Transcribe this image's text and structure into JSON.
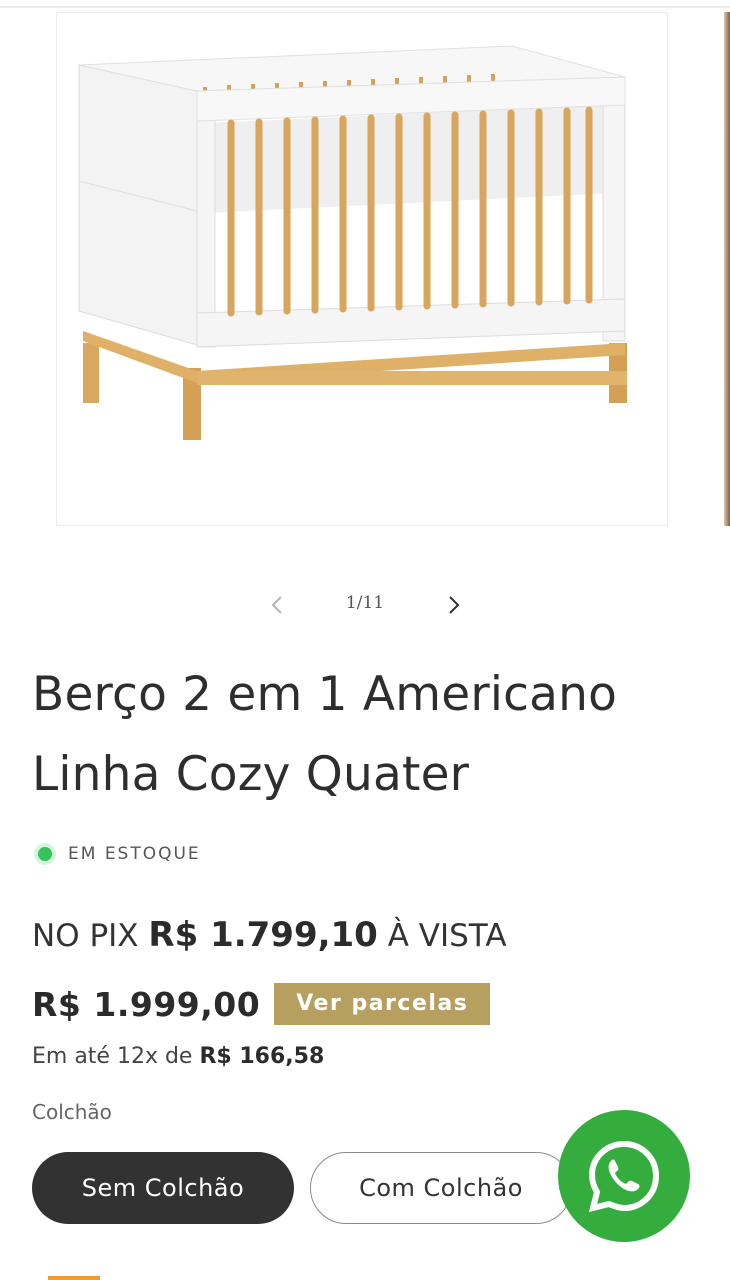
{
  "gallery": {
    "image_alt": "Berço 2 em 1 Americano Linha Cozy Quater",
    "counter": "1/11"
  },
  "product": {
    "title_line1": "Berço 2 em 1 Americano",
    "title_line2": "Linha Cozy Quater",
    "stock_status": "EM ESTOQUE",
    "pix_prefix": "NO PIX",
    "pix_price": "R$ 1.799,10",
    "pix_suffix": "À VISTA",
    "price": "R$ 1.999,00",
    "installments_button": "Ver parcelas",
    "installments_prefix": "Em até 12x de",
    "installments_value": "R$ 166,58"
  },
  "variant": {
    "label": "Colchão",
    "options": [
      "Sem Colchão",
      "Com Colchão"
    ],
    "selected": "Sem Colchão"
  },
  "icons": {
    "prev": "chevron-left-icon",
    "next": "chevron-right-icon",
    "whatsapp": "whatsapp-icon"
  },
  "colors": {
    "stock_green": "#35c35a",
    "gold_accent": "#b7a05f",
    "whatsapp_green": "#35ad3e",
    "selected_pill": "#323232"
  }
}
